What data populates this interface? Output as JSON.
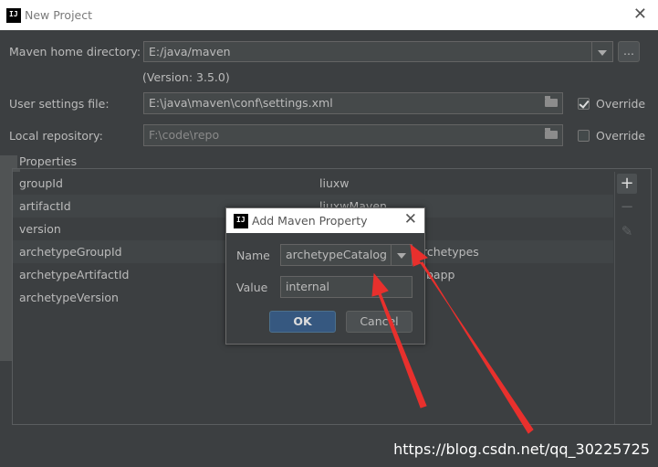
{
  "window": {
    "title": "New Project",
    "app_icon": "IJ"
  },
  "maven": {
    "home_label": "Maven home directory:",
    "home_value": "E:/java/maven",
    "browse_label": "...",
    "version": "(Version: 3.5.0)",
    "settings_label": "User settings file:",
    "settings_value": "E:\\java\\maven\\conf\\settings.xml",
    "settings_override": "Override",
    "settings_override_checked": true,
    "repo_label": "Local repository:",
    "repo_value": "F:\\code\\repo",
    "repo_override": "Override",
    "repo_override_checked": false
  },
  "properties": {
    "title": "Properties",
    "rows": [
      {
        "key": "groupId",
        "value": "liuxw"
      },
      {
        "key": "artifactId",
        "value": "liuxwMaven"
      },
      {
        "key": "version",
        "value": ""
      },
      {
        "key": "archetypeGroupId",
        "value": "rchetypes"
      },
      {
        "key": "archetypeArtifactId",
        "value": "bapp"
      },
      {
        "key": "archetypeVersion",
        "value": ""
      }
    ],
    "add_icon": "plus-icon",
    "remove_icon": "minus-icon",
    "edit_icon": "pencil-icon"
  },
  "dialog": {
    "title": "Add Maven Property",
    "name_label": "Name",
    "name_value": "archetypeCatalog",
    "value_label": "Value",
    "value_value": "internal",
    "ok_label": "OK",
    "cancel_label": "Cancel"
  },
  "watermark": "https://blog.csdn.net/qq_30225725",
  "colors": {
    "accent": "#365880",
    "annotation_arrow": "#e8302d",
    "background": "#3c3f41"
  }
}
